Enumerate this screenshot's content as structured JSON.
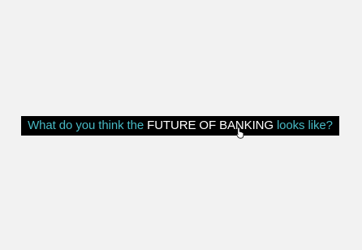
{
  "headline": {
    "part1": "What do you think the ",
    "highlight": "FUTURE OF BANKING",
    "part2": " looks like?"
  },
  "colors": {
    "background": "#f2f2f2",
    "banner": "#000000",
    "accent_text": "#47b8c3",
    "highlight_text": "#ffffff"
  },
  "cursor": {
    "icon": "hand-pointer-icon"
  }
}
